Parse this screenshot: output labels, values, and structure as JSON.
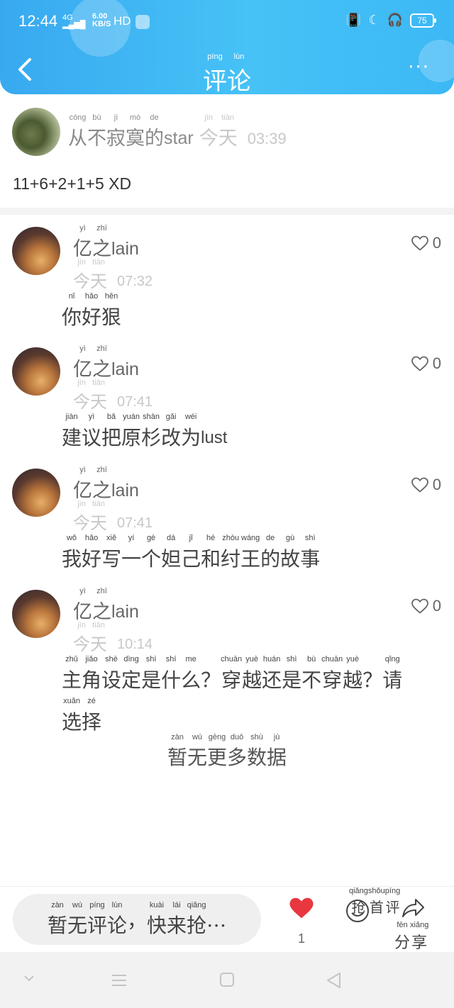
{
  "status_bar": {
    "time": "12:44",
    "network": "4G",
    "speed_value": "6.00",
    "speed_unit": "KB/S",
    "hd": "HD",
    "battery": "75"
  },
  "header": {
    "title": [
      {
        "py": "píng",
        "hz": "评"
      },
      {
        "py": "lùn",
        "hz": "论"
      }
    ],
    "accent_color": "#3fb4f3"
  },
  "post": {
    "author": [
      {
        "py": "cóng",
        "hz": "从"
      },
      {
        "py": "bù",
        "hz": "不"
      },
      {
        "py": "jì",
        "hz": "寂"
      },
      {
        "py": "mò",
        "hz": "寞"
      },
      {
        "py": "de",
        "hz": "的"
      }
    ],
    "author_latin": "star",
    "day": [
      {
        "py": "jīn",
        "hz": "今"
      },
      {
        "py": "tiān",
        "hz": "天"
      }
    ],
    "time": "03:39",
    "content": "11+6+2+1+5  XD"
  },
  "comments": [
    {
      "name": [
        {
          "py": "yì",
          "hz": "亿"
        },
        {
          "py": "zhī",
          "hz": "之"
        }
      ],
      "name_latin": "lain",
      "day": [
        {
          "py": "jīn",
          "hz": "今"
        },
        {
          "py": "tiān",
          "hz": "天"
        }
      ],
      "time": "07:32",
      "likes": "0",
      "text": [
        {
          "py": "nǐ",
          "hz": "你"
        },
        {
          "py": "hǎo",
          "hz": "好"
        },
        {
          "py": "hěn",
          "hz": "狠"
        }
      ]
    },
    {
      "name": [
        {
          "py": "yì",
          "hz": "亿"
        },
        {
          "py": "zhī",
          "hz": "之"
        }
      ],
      "name_latin": "lain",
      "day": [
        {
          "py": "jīn",
          "hz": "今"
        },
        {
          "py": "tiān",
          "hz": "天"
        }
      ],
      "time": "07:41",
      "likes": "0",
      "text": [
        {
          "py": "jiàn",
          "hz": "建"
        },
        {
          "py": "yì",
          "hz": "议"
        },
        {
          "py": "bǎ",
          "hz": "把"
        },
        {
          "py": "yuán",
          "hz": "原"
        },
        {
          "py": "shān",
          "hz": "杉"
        },
        {
          "py": "gǎi",
          "hz": "改"
        },
        {
          "py": "wéi",
          "hz": "为"
        },
        {
          "lat": "lust"
        }
      ]
    },
    {
      "name": [
        {
          "py": "yì",
          "hz": "亿"
        },
        {
          "py": "zhī",
          "hz": "之"
        }
      ],
      "name_latin": "lain",
      "day": [
        {
          "py": "jīn",
          "hz": "今"
        },
        {
          "py": "tiān",
          "hz": "天"
        }
      ],
      "time": "07:41",
      "likes": "0",
      "text": [
        {
          "py": "wǒ",
          "hz": "我"
        },
        {
          "py": "hǎo",
          "hz": "好"
        },
        {
          "py": "xiě",
          "hz": "写"
        },
        {
          "py": "yí",
          "hz": "一"
        },
        {
          "py": "gè",
          "hz": "个"
        },
        {
          "py": "dá",
          "hz": "妲"
        },
        {
          "py": "jǐ",
          "hz": "己"
        },
        {
          "py": "hé",
          "hz": "和"
        },
        {
          "py": "zhòu",
          "hz": "纣"
        },
        {
          "py": "wáng",
          "hz": "王"
        },
        {
          "py": "de",
          "hz": "的"
        },
        {
          "py": "gù",
          "hz": "故"
        },
        {
          "py": "shì",
          "hz": "事"
        }
      ]
    },
    {
      "name": [
        {
          "py": "yì",
          "hz": "亿"
        },
        {
          "py": "zhī",
          "hz": "之"
        }
      ],
      "name_latin": "lain",
      "day": [
        {
          "py": "jīn",
          "hz": "今"
        },
        {
          "py": "tiān",
          "hz": "天"
        }
      ],
      "time": "10:14",
      "likes": "0",
      "text": [
        {
          "py": "zhǔ",
          "hz": "主"
        },
        {
          "py": "jiǎo",
          "hz": "角"
        },
        {
          "py": "shè",
          "hz": "设"
        },
        {
          "py": "dìng",
          "hz": "定"
        },
        {
          "py": "shì",
          "hz": "是"
        },
        {
          "py": "shí",
          "hz": "什"
        },
        {
          "py": "me",
          "hz": "么"
        },
        {
          "py": "",
          "hz": "？"
        },
        {
          "py": "chuān",
          "hz": "穿"
        },
        {
          "py": "yuè",
          "hz": "越"
        },
        {
          "py": "huán",
          "hz": "还"
        },
        {
          "py": "shì",
          "hz": "是"
        },
        {
          "py": "bù",
          "hz": "不"
        },
        {
          "py": "chuān",
          "hz": "穿"
        },
        {
          "py": "yuè",
          "hz": "越"
        },
        {
          "py": "",
          "hz": "？"
        },
        {
          "py": "qǐng",
          "hz": "请"
        },
        {
          "py": "xuǎn",
          "hz": "选"
        },
        {
          "py": "zé",
          "hz": "择"
        }
      ]
    }
  ],
  "no_more": [
    {
      "py": "zàn",
      "hz": "暂"
    },
    {
      "py": "wú",
      "hz": "无"
    },
    {
      "py": "gēng",
      "hz": "更"
    },
    {
      "py": "duō",
      "hz": "多"
    },
    {
      "py": "shù",
      "hz": "数"
    },
    {
      "py": "jù",
      "hz": "据"
    }
  ],
  "bottom": {
    "input_placeholder": [
      {
        "py": "zàn",
        "hz": "暂"
      },
      {
        "py": "wú",
        "hz": "无"
      },
      {
        "py": "píng",
        "hz": "评"
      },
      {
        "py": "lùn",
        "hz": "论"
      },
      {
        "py": "",
        "hz": "，"
      },
      {
        "py": "kuài",
        "hz": "快"
      },
      {
        "py": "lái",
        "hz": "来"
      },
      {
        "py": "qiǎng",
        "hz": "抢"
      },
      {
        "py": "",
        "hz": "…"
      }
    ],
    "like_count": "1",
    "first_comment": [
      {
        "py": "qiǎng",
        "hz": "抢"
      },
      {
        "py": "shǒu",
        "hz": "首"
      },
      {
        "py": "píng",
        "hz": "评"
      }
    ],
    "share": [
      {
        "py": "fēn",
        "hz": "分"
      },
      {
        "py": "xiǎng",
        "hz": "享"
      }
    ],
    "like_color": "#e8373f"
  }
}
